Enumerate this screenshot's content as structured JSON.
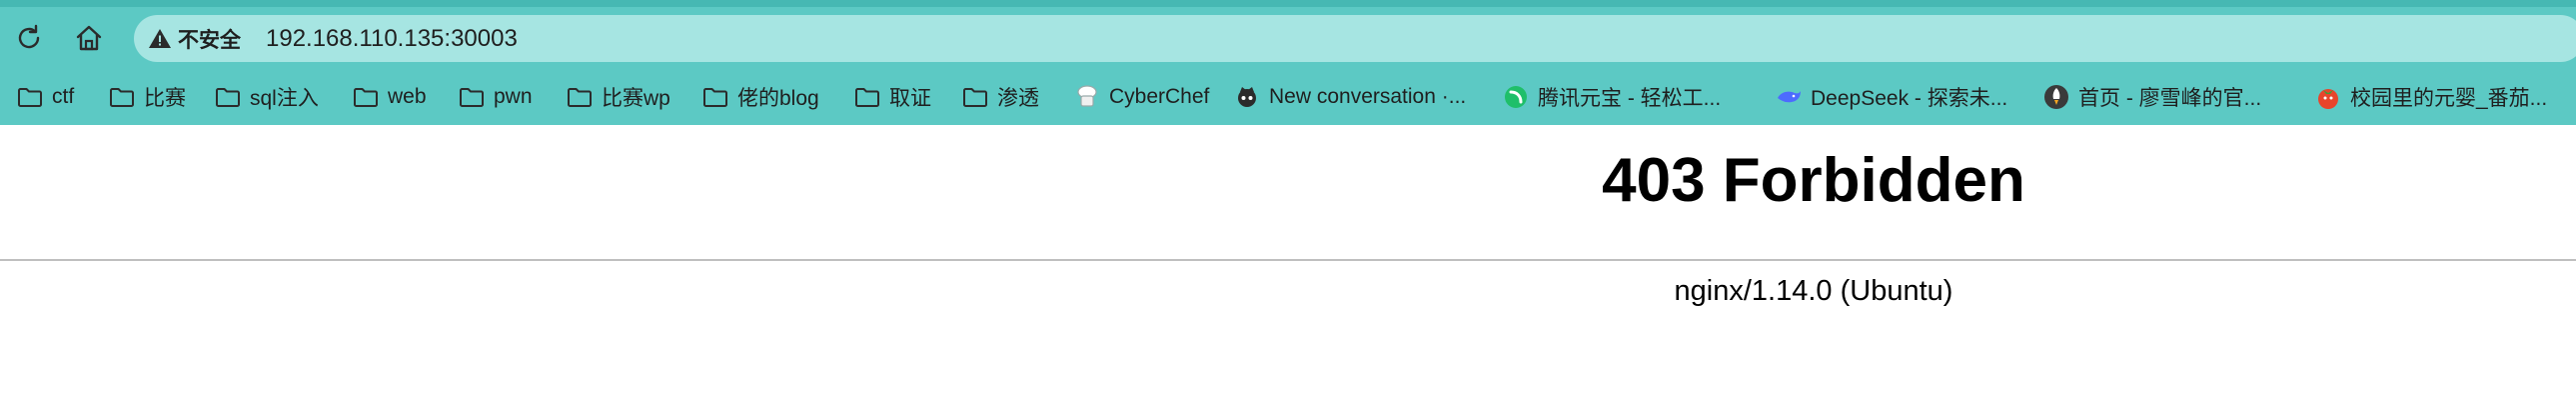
{
  "browser": {
    "security_label": "不安全",
    "url": "192.168.110.135:30003",
    "accent_color": "#5cc9c4",
    "address_bar_color": "#a6e5e2",
    "bookmarks": [
      {
        "label": "ctf",
        "icon": "folder-icon"
      },
      {
        "label": "比赛",
        "icon": "folder-icon"
      },
      {
        "label": "sql注入",
        "icon": "folder-icon"
      },
      {
        "label": "web",
        "icon": "folder-icon"
      },
      {
        "label": "pwn",
        "icon": "folder-icon"
      },
      {
        "label": "比赛wp",
        "icon": "folder-icon"
      },
      {
        "label": "佬的blog",
        "icon": "folder-icon"
      },
      {
        "label": "取证",
        "icon": "folder-icon"
      },
      {
        "label": "渗透",
        "icon": "folder-icon"
      },
      {
        "label": "CyberChef",
        "icon": "cyberchef-icon"
      },
      {
        "label": "New conversation ·...",
        "icon": "github-icon"
      },
      {
        "label": "腾讯元宝 - 轻松工...",
        "icon": "yuanbao-icon"
      },
      {
        "label": "DeepSeek - 探索未...",
        "icon": "deepseek-icon"
      },
      {
        "label": "首页 - 廖雪峰的官...",
        "icon": "rocket-icon"
      },
      {
        "label": "校园里的元婴_番茄...",
        "icon": "tomato-icon"
      }
    ]
  },
  "page": {
    "title": "403 Forbidden",
    "server": "nginx/1.14.0 (Ubuntu)"
  }
}
